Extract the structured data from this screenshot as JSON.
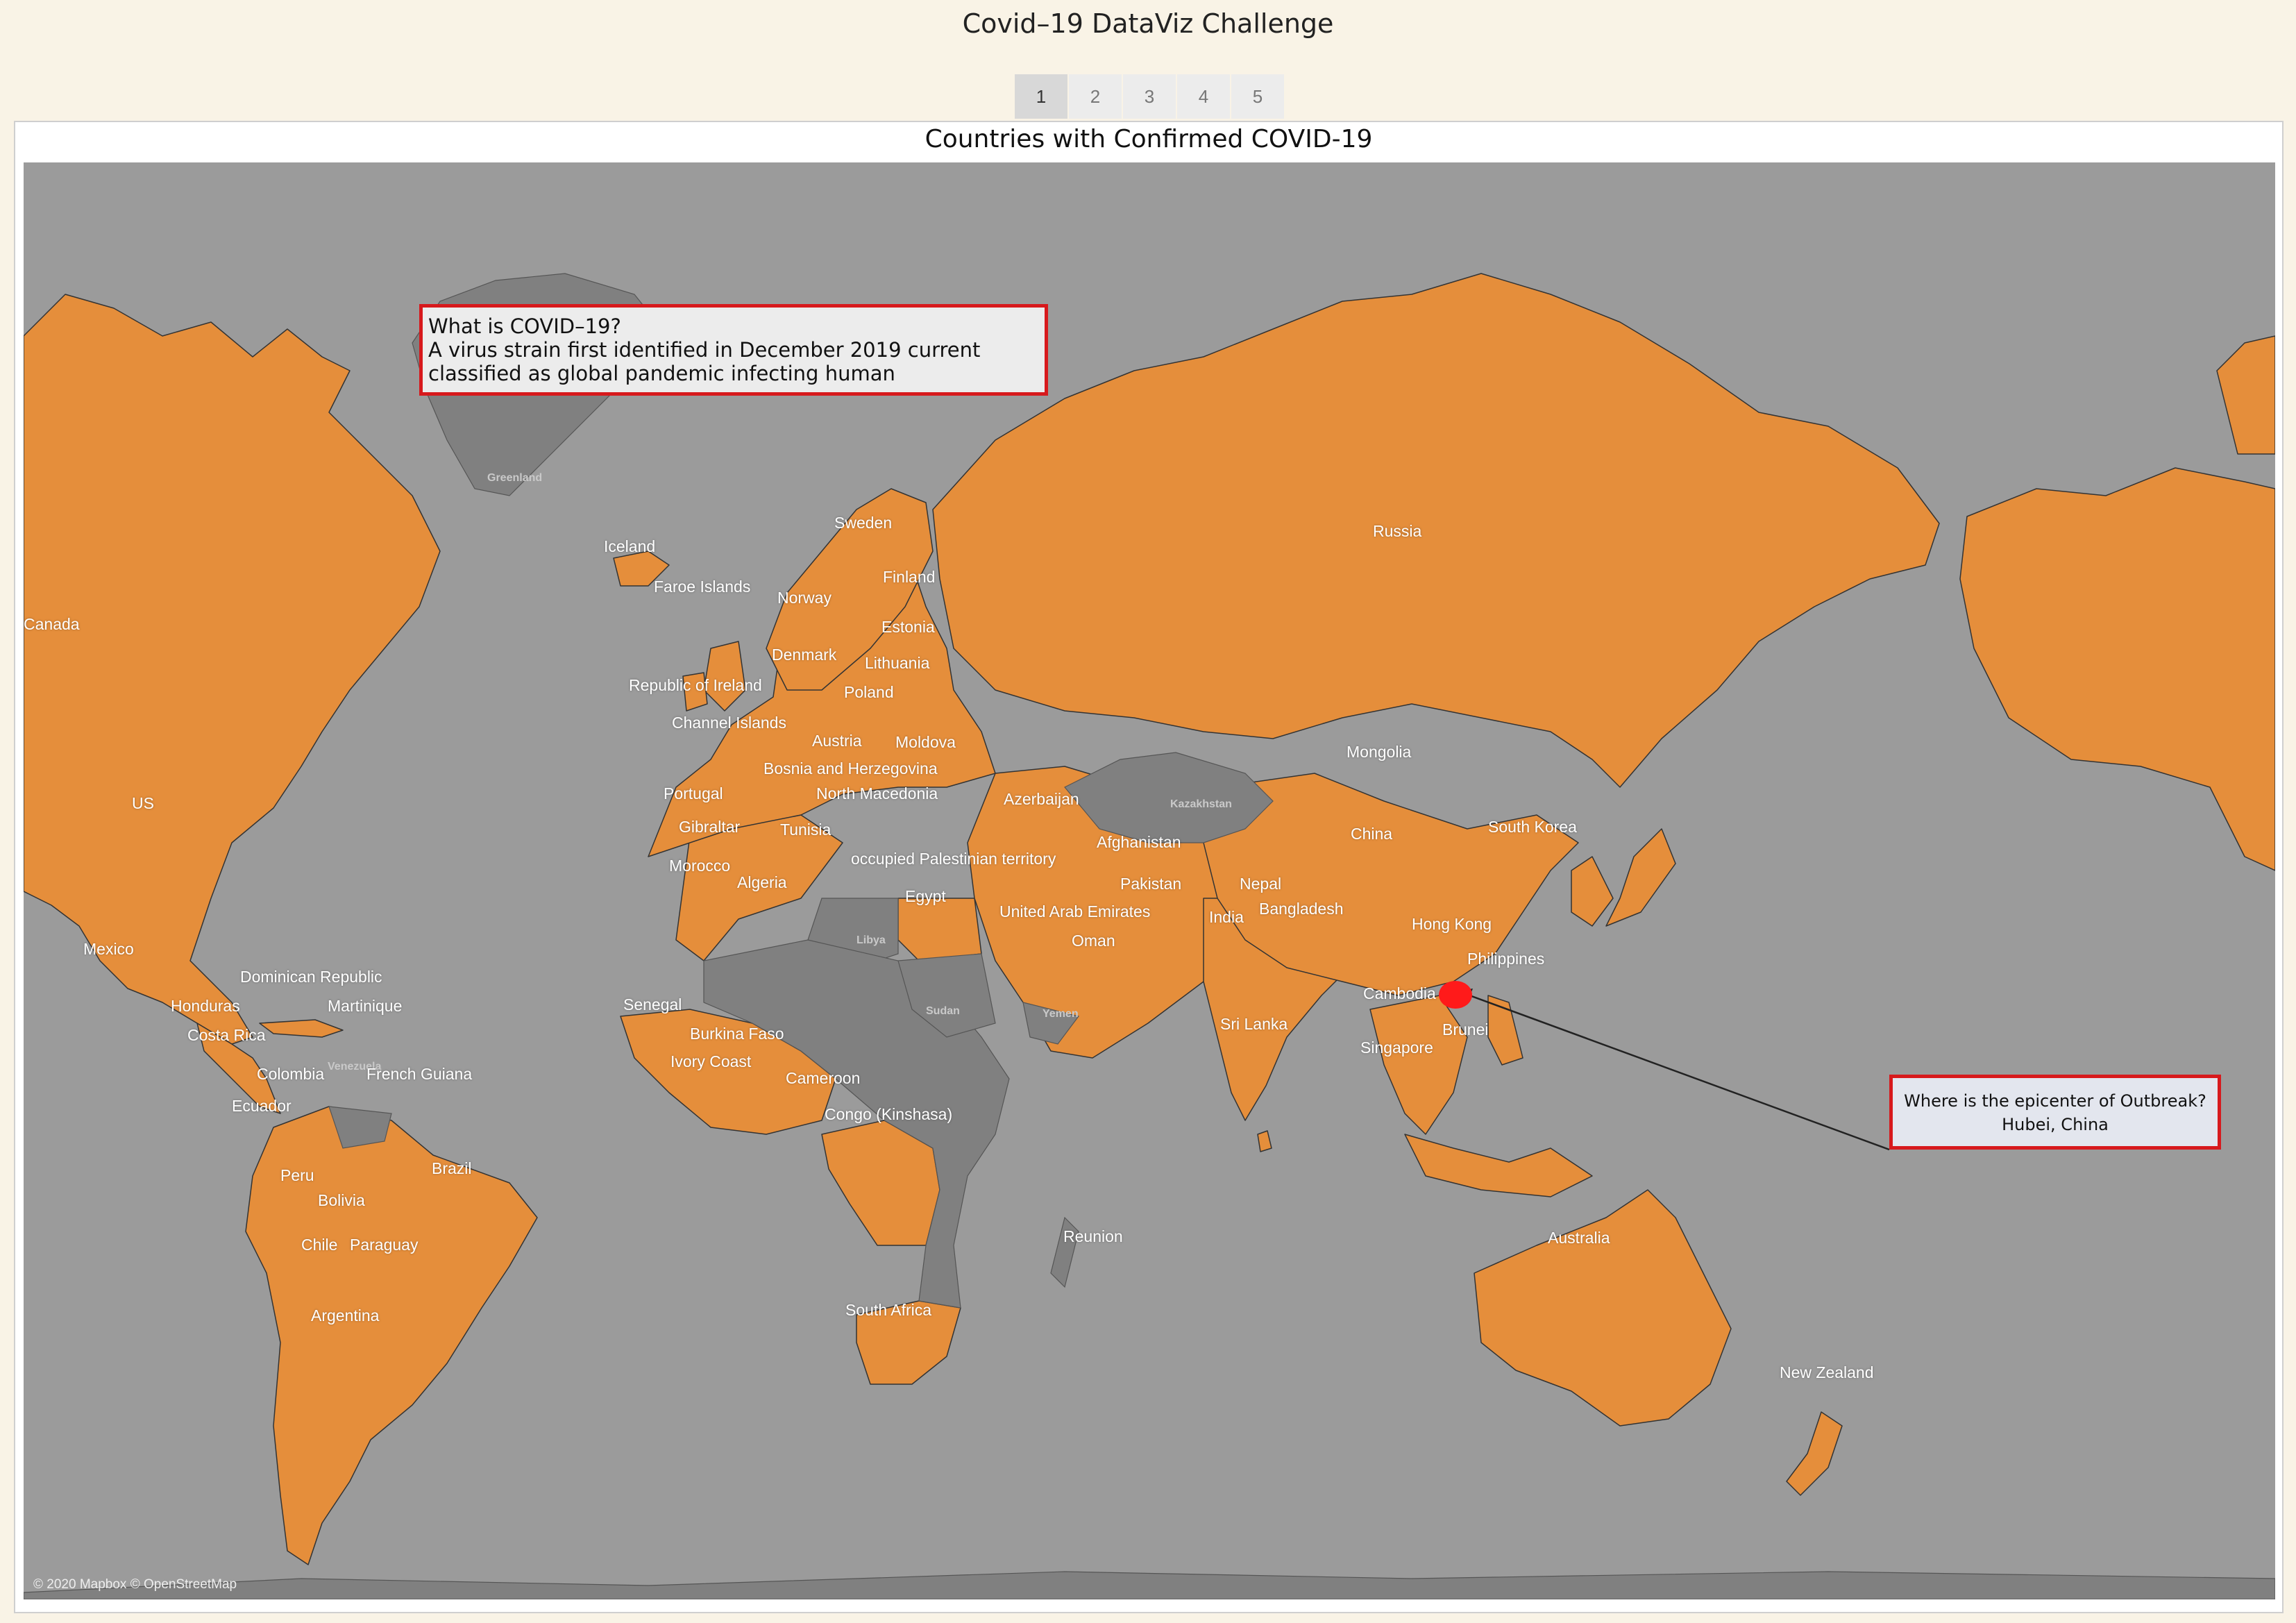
{
  "app_title": "Covid–19 DataViz Challenge",
  "pages": [
    "1",
    "2",
    "3",
    "4",
    "5"
  ],
  "active_page": "1",
  "dashboard_title": "Countries with Confirmed COVID-19",
  "colors": {
    "confirmed": "#e58e3b",
    "no_data": "#808080",
    "ocean": "#9b9b9b",
    "epicenter": "#ff1a1a",
    "annotation_border": "#d7191c"
  },
  "info_box": {
    "line1": "What is COVID–19?",
    "line2": "A virus strain first identified in December 2019 current",
    "line3": "classified as global pandemic infecting human"
  },
  "epicenter_box": {
    "line1": "Where is the epicenter of Outbreak?",
    "line2": "Hubei, China"
  },
  "country_labels": {
    "iceland": "Iceland",
    "faroe": "Faroe Islands",
    "sweden": "Sweden",
    "norway": "Norway",
    "finland": "Finland",
    "estonia": "Estonia",
    "denmark": "Denmark",
    "lithuania": "Lithuania",
    "ireland": "Republic of Ireland",
    "poland": "Poland",
    "channel": "Channel Islands",
    "austria": "Austria",
    "moldova": "Moldova",
    "bosnia": "Bosnia and Herzegovina",
    "portugal": "Portugal",
    "macedonia": "North Macedonia",
    "azerbaijan": "Azerbaijan",
    "gibraltar": "Gibraltar",
    "tunisia": "Tunisia",
    "morocco": "Morocco",
    "algeria": "Algeria",
    "palestine": "occupied Palestinian territory",
    "egypt": "Egypt",
    "afghanistan": "Afghanistan",
    "pakistan": "Pakistan",
    "nepal": "Nepal",
    "uae": "United Arab Emirates",
    "oman": "Oman",
    "india": "India",
    "bangladesh": "Bangladesh",
    "russia": "Russia",
    "mongolia": "Mongolia",
    "china": "China",
    "south_korea": "South Korea",
    "hong_kong": "Hong Kong",
    "philippines": "Philippines",
    "cambodia": "Cambodia",
    "sri_lanka": "Sri Lanka",
    "brunei": "Brunei",
    "singapore": "Singapore",
    "australia": "Australia",
    "new_zealand": "New Zealand",
    "canada": "Canada",
    "us": "US",
    "mexico": "Mexico",
    "dominican": "Dominican Republic",
    "honduras": "Honduras",
    "martinique": "Martinique",
    "costa_rica": "Costa Rica",
    "colombia": "Colombia",
    "french_guiana": "French Guiana",
    "ecuador": "Ecuador",
    "brazil": "Brazil",
    "peru": "Peru",
    "bolivia": "Bolivia",
    "chile": "Chile",
    "paraguay": "Paraguay",
    "argentina": "Argentina",
    "senegal": "Senegal",
    "burkina": "Burkina Faso",
    "ivory": "Ivory Coast",
    "cameroon": "Cameroon",
    "congo": "Congo (Kinshasa)",
    "reunion": "Reunion",
    "south_africa": "South Africa"
  },
  "greyed_labels": {
    "greenland": "Greenland",
    "kazakhstan": "Kazakhstan",
    "libya": "Libya",
    "sudan": "Sudan",
    "yemen": "Yemen",
    "venezuela": "Venezuela"
  },
  "copyright": "© 2020 Mapbox © OpenStreetMap"
}
